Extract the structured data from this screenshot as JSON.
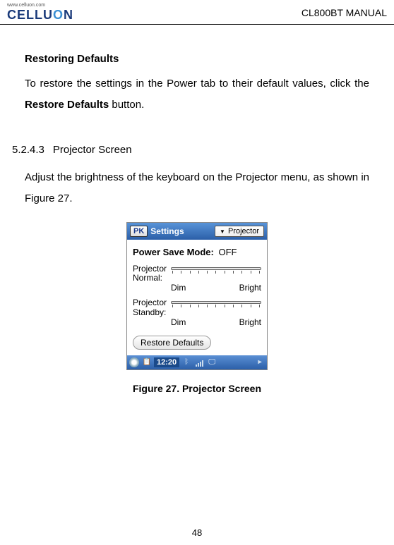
{
  "header": {
    "logo_top": "www.celluon.com",
    "logo_text_pre": "CELLU",
    "logo_text_o": "O",
    "logo_text_post": "N",
    "manual": "CL800BT MANUAL"
  },
  "section1": {
    "title": "Restoring Defaults",
    "line1": "To restore the settings in the Power tab to their default values, click the ",
    "bold": "Restore Defaults",
    "line2": " button."
  },
  "subsection": {
    "num": "5.2.4.3",
    "title": "Projector Screen"
  },
  "section2": {
    "text": "Adjust the brightness of the keyboard on the Projector menu, as shown in Figure 27."
  },
  "device": {
    "pk": "PK",
    "settings": "Settings",
    "dropdown": "Projector",
    "psm_label": "Power Save Mode:",
    "psm_value": "OFF",
    "slider1_label1": "Projector",
    "slider1_label2": "Normal:",
    "slider2_label1": "Projector",
    "slider2_label2": "Standby:",
    "dim": "Dim",
    "bright": "Bright",
    "restore": "Restore Defaults",
    "time": "12:20"
  },
  "caption": "Figure 27. Projector Screen",
  "page": "48"
}
